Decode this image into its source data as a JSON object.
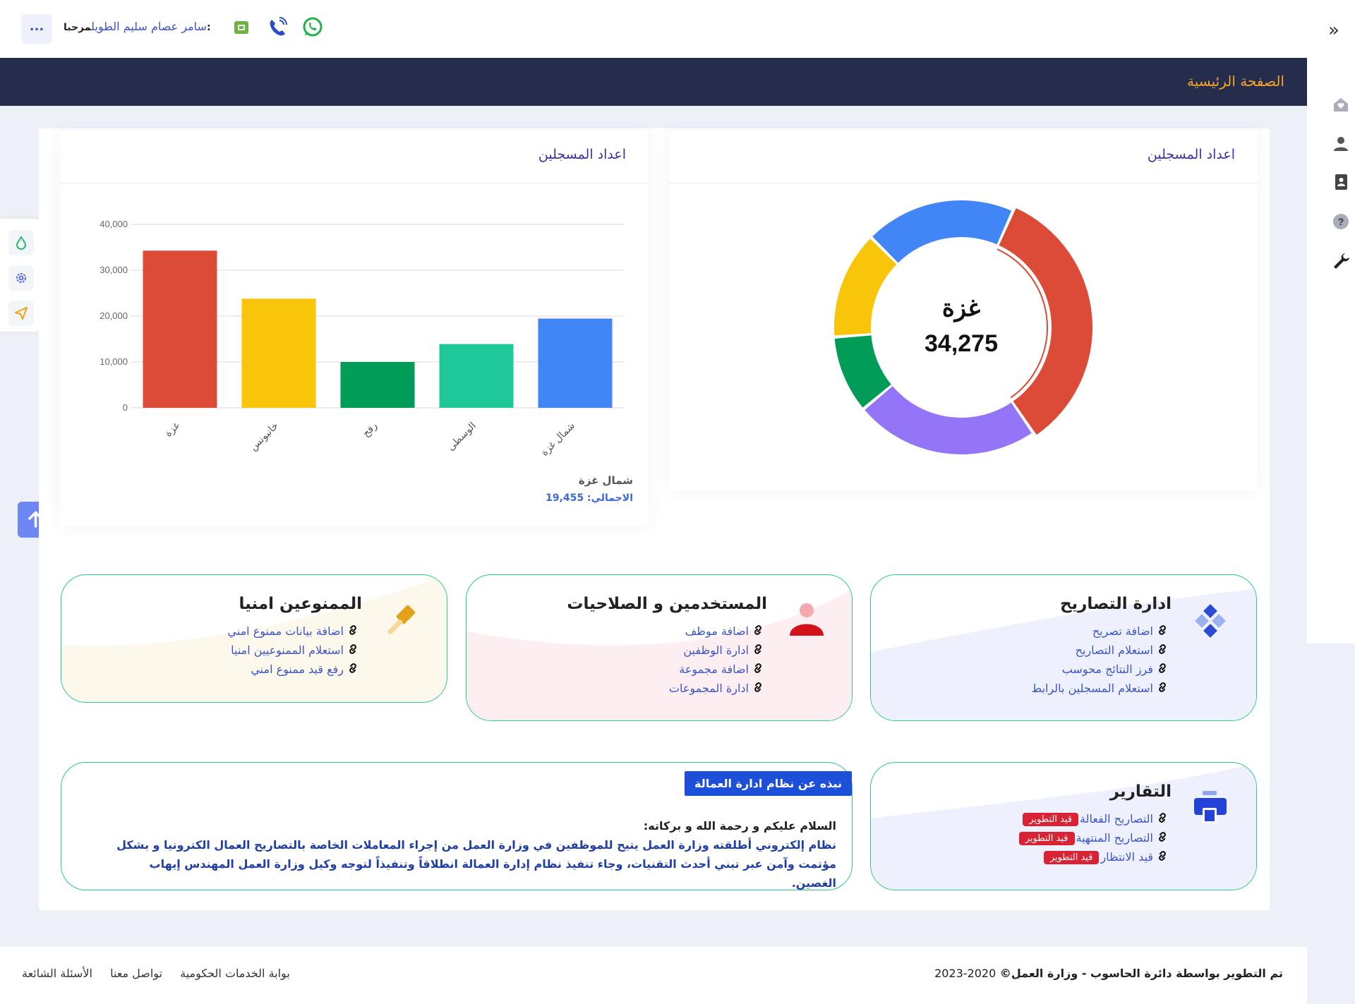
{
  "header": {
    "more_label": "...",
    "greeting": "مرحبا:",
    "user_name": "سامر عصام سليم الطويل",
    "icons": [
      "sim-card-icon",
      "phone-icon",
      "whatsapp-icon"
    ]
  },
  "pagebar": {
    "title": "الصفحة الرئيسية"
  },
  "right_strip": {
    "icons": [
      "collapse-chevrons-icon",
      "home-icon",
      "user-icon",
      "contact-card-icon",
      "help-icon",
      "wrench-icon"
    ]
  },
  "left_tools": {
    "icons": [
      "drop-icon",
      "settings-gear-icon",
      "send-icon"
    ]
  },
  "bar_card": {
    "title": "اعداد المسجلين",
    "footer_name": "شمال غزة",
    "footer_total_label": "الاجمالي:",
    "footer_total_value": "19,455"
  },
  "donut_card": {
    "title": "اعداد المسجلين",
    "center_label": "غزة",
    "center_value": "34,275"
  },
  "chart_data": [
    {
      "type": "bar",
      "categories": [
        "غزة",
        "خانيونس",
        "رفح",
        "الوسطى",
        "شمال غزة"
      ],
      "values": [
        34275,
        23800,
        10000,
        13900,
        19455
      ],
      "colors": [
        "#dc4b38",
        "#f8c50a",
        "#019d58",
        "#1fc997",
        "#4286f6"
      ],
      "yticks": [
        "0",
        "10,000",
        "20,000",
        "30,000",
        "40,000"
      ],
      "ylim": [
        0,
        40000
      ],
      "grid": true
    },
    {
      "type": "pie",
      "categories": [
        "غزة",
        "خانيونس",
        "رفح",
        "الوسطى",
        "شمال غزة"
      ],
      "values": [
        34275,
        23800,
        10000,
        13900,
        19455
      ],
      "colors": [
        "#dc4b38",
        "#9475f7",
        "#019d58",
        "#f8c50a",
        "#4286f6"
      ],
      "highlighted": "غزة"
    }
  ],
  "boxes": {
    "permits": {
      "title": "ادارة التصاريح",
      "icon": "diamonds-icon",
      "links": [
        "اضافة تصريح",
        "استعلام التصاريح",
        "فرز النتائج محوسب",
        "استعلام المسجلين بالرابط"
      ]
    },
    "users": {
      "title": "المستخدمين و الصلاحيات",
      "icon": "user-person-icon",
      "links": [
        "اضافة موظف",
        "ادارة الوظفين",
        "اضافة مجموعة",
        "ادارة المجموعات"
      ]
    },
    "banned": {
      "title": "الممنوعين امنيا",
      "icon": "gavel-icon",
      "links": [
        "اضافة بيانات ممنوع امني",
        "استعلام الممنوعيين امنيا",
        "رفع قيد ممنوع امني"
      ]
    },
    "reports": {
      "title": "التقارير",
      "icon": "printer-icon",
      "links": [
        "التصاريح الفعالة",
        "التصاريح المنتهية",
        "قيد الانتظار"
      ],
      "badge": "قيد التطوير"
    }
  },
  "about": {
    "tag": "نبذه عن نظام ادارة العمالة",
    "greeting": "السلام عليكم و رحمة الله و بركاته:",
    "body": "نظام إلكتروني أطلقته وزارة العمل يتيح للموظفين في وزارة العمل من إجراء المعاملات الخاصة بالتصاريح العمال الكترونيا و بشكل مؤتمت وآمن عبر تبني أحدث التقنيات، وجاء تنفيذ نظام إدارة العمالة انطلاقاً وتنفيذاً لتوجه وكيل وزارة العمل المهندس إيهاب الغصين."
  },
  "footer": {
    "credit": "تم التطوير بواسطة دائرة الحاسوب - وزارة العمل©",
    "years": "2020-2023",
    "links": [
      "بوابة الخدمات الحكومية",
      "تواصل معنا",
      "الأسئلة الشائعة"
    ]
  },
  "colors": {
    "accent": "#3b55c7",
    "navbar": "#252c4c",
    "page_title": "#f8a62b",
    "box_border": "#2ec98b",
    "badge": "#d92334"
  }
}
